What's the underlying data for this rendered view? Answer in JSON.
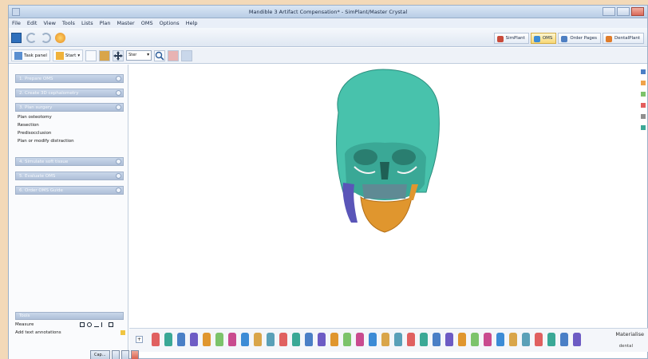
{
  "window": {
    "title": "Mandible 3 Artifact Compensation* - SimPlant/Master Crystal"
  },
  "menu": [
    "File",
    "Edit",
    "View",
    "Tools",
    "Lists",
    "Plan",
    "Master",
    "OMS",
    "Options",
    "Help"
  ],
  "product_tabs": [
    {
      "label": "SimPlant",
      "color": "#c94b3b"
    },
    {
      "label": "OMS",
      "color": "#3c8bd6"
    },
    {
      "label": "Order Pages",
      "color": "#4e7fc2"
    },
    {
      "label": "DentalPlant",
      "color": "#e07c2a"
    }
  ],
  "toolbar": {
    "task_panel_label": "Task panel",
    "start_label": "Start",
    "view_select_value": "Ster"
  },
  "sidebar": {
    "sections": [
      {
        "label": "1. Prepare OMS"
      },
      {
        "label": "2. Create 3D cephalometry"
      },
      {
        "label": "3. Plan surgery"
      },
      {
        "label": "4. Simulate soft tissue"
      },
      {
        "label": "5. Evaluate OMS"
      },
      {
        "label": "6. Order OMS Guide"
      }
    ],
    "plan_items": [
      "Plan osteotomy",
      "Resection",
      "Predisocclusion",
      "Plan or modify distraction"
    ]
  },
  "tools": {
    "header": "Tools",
    "measure_label": "Measure",
    "annotations_label": "Add text annotations"
  },
  "taskbar": {
    "capture_label": "Cap..."
  },
  "footer": {
    "logo_text": "Materialise",
    "sub_text": "dental"
  },
  "colors": {
    "skull": "#48c2ac",
    "mandible": "#e0962e",
    "tab_active": "#f7d774",
    "section": "#aebfd8"
  },
  "implant_library": {
    "count": 34
  }
}
